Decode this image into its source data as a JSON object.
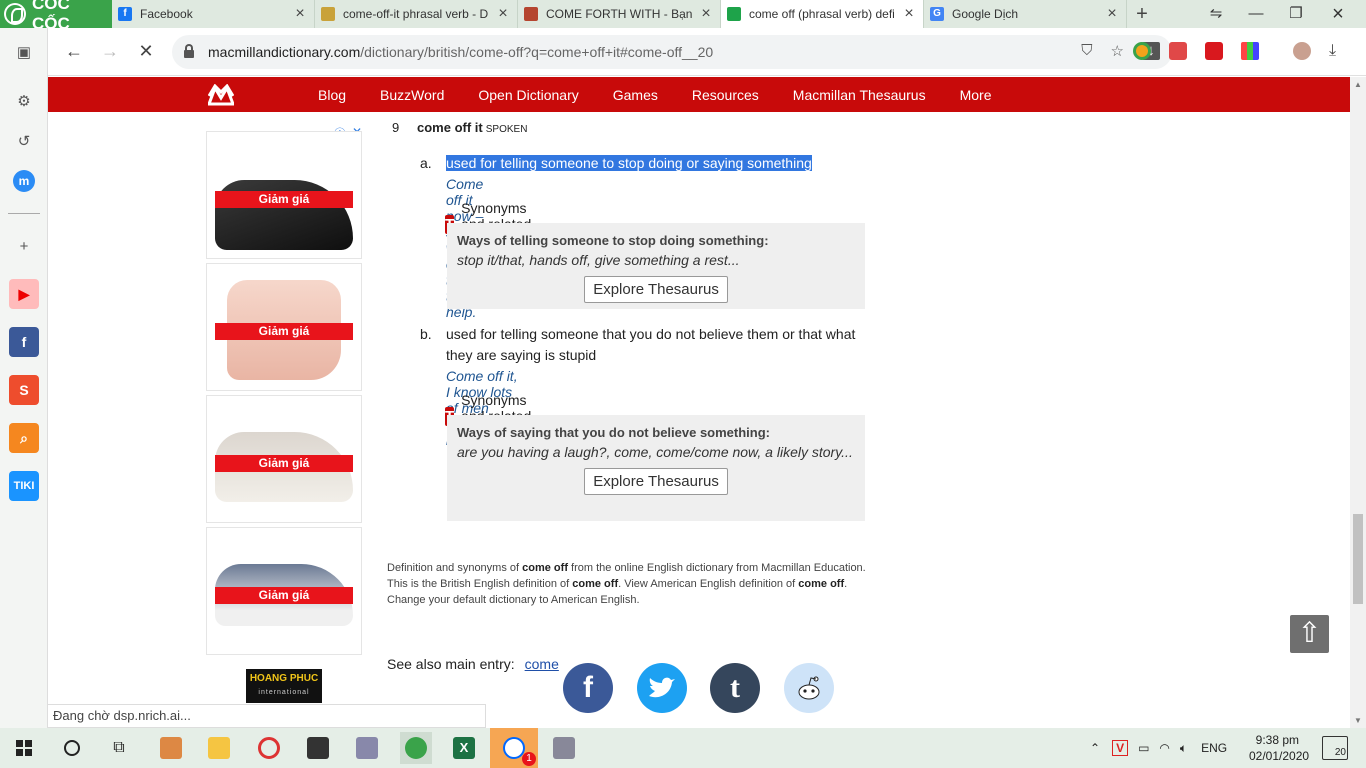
{
  "browser": {
    "brand": "CỐC CỐC",
    "tabs": [
      {
        "title": "Facebook",
        "favicon": "facebook-icon",
        "color": "#1877f2"
      },
      {
        "title": "come-off-it phrasal verb - D",
        "favicon": "oxford-icon",
        "color": "#c9a23a"
      },
      {
        "title": "COME FORTH WITH - Bạn d",
        "favicon": "cambridge-icon",
        "color": "#b5452f"
      },
      {
        "title": "come off (phrasal verb) defi",
        "favicon": "macmillan-icon",
        "color": "#1ea34a",
        "active": true
      },
      {
        "title": "Google Dịch",
        "favicon": "google-translate-icon",
        "color": "#4285f4"
      }
    ],
    "url_host": "macmillandictionary.com",
    "url_path": "/dictionary/british/come-off?q=come+off+it#come-off__20",
    "status": "Đang chờ dsp.nrich.ai..."
  },
  "site_nav": {
    "links": [
      "Blog",
      "BuzzWord",
      "Open Dictionary",
      "Games",
      "Resources",
      "Macmillan Thesaurus",
      "More"
    ],
    "accent": "#c80a0a"
  },
  "ads": {
    "sale_label": "Giảm giá",
    "info_icon": "info-icon",
    "close_icon": "close-icon",
    "logo_text": "HOANG PHUC",
    "logo_sub": "international"
  },
  "entry": {
    "number": "9",
    "phrase": "come off it",
    "register": "SPOKEN",
    "senses": [
      {
        "letter": "a.",
        "definition": "used for telling someone to stop doing or saying something",
        "example": "Come off it now – she was only trying to help.",
        "synonyms_label": "Synonyms and related words",
        "thesaurus_title": "Ways of telling someone to stop doing something:",
        "thesaurus_list": "stop it/that, hands off, give something a rest...",
        "button": "Explore Thesaurus"
      },
      {
        "letter": "b.",
        "definition": "used for telling someone that you do not believe them or that what they are saying is stupid",
        "example": "Come off it, I know lots of men who do housework.",
        "synonyms_label": "Synonyms and related words",
        "thesaurus_title": "Ways of saying that you do not believe something:",
        "thesaurus_list": "are you having a laugh?, come, come/come now, a likely story...",
        "button": "Explore Thesaurus"
      }
    ]
  },
  "footnote": {
    "l1a": "Definition and synonyms of ",
    "l1b": "come off",
    "l1c": " from the online English dictionary from Macmillan Education.",
    "l2a": "This is the British English definition of ",
    "l2b": "come off",
    "l2c": ". View American English definition of ",
    "l2d": "come off",
    "l2e": ".",
    "l3": "Change your default dictionary to American English."
  },
  "see_also": {
    "label": "See also main entry:",
    "link": "come"
  },
  "social": [
    {
      "name": "facebook-share-icon",
      "glyph": "f",
      "color": "#3b5998"
    },
    {
      "name": "twitter-share-icon",
      "glyph": "t",
      "color": "#1da1f2"
    },
    {
      "name": "tumblr-share-icon",
      "glyph": "t",
      "color": "#35465c"
    },
    {
      "name": "reddit-share-icon",
      "glyph": "r",
      "color": "#cee3f8"
    }
  ],
  "taskbar": {
    "lang": "ENG",
    "time": "9:38 pm",
    "date": "02/01/2020",
    "notif_count": "20",
    "zalo_badge": "1"
  }
}
